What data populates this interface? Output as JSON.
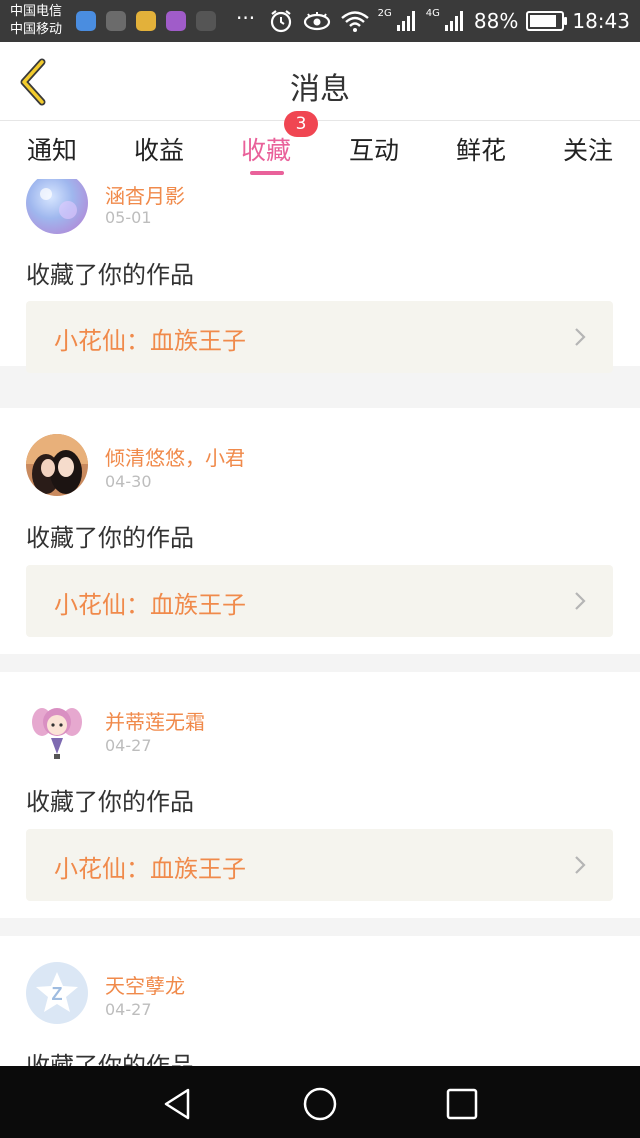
{
  "status_bar": {
    "carrier_1": "中国电信",
    "carrier_2": "中国移动",
    "more": "···",
    "net_2g": "2G",
    "net_4g": "4G",
    "battery_text": "88%",
    "battery_level": 0.88,
    "time": "18:43"
  },
  "header": {
    "title": "消息",
    "back_icon": "chevron-left-icon",
    "accent": "#e9619a"
  },
  "tabs": [
    {
      "label": "通知"
    },
    {
      "label": "收益"
    },
    {
      "label": "收藏",
      "active": true,
      "badge": "3"
    },
    {
      "label": "互动"
    },
    {
      "label": "鲜花"
    },
    {
      "label": "关注"
    }
  ],
  "messages": [
    {
      "user": "涵杳月影",
      "date": "05-01",
      "action": "收藏了你的作品",
      "work": "小花仙：血族王子"
    },
    {
      "user": "倾清悠悠，小君",
      "date": "04-30",
      "action": "收藏了你的作品",
      "work": "小花仙：血族王子"
    },
    {
      "user": "并蒂莲无霜",
      "date": "04-27",
      "action": "收藏了你的作品",
      "work": "小花仙：血族王子"
    },
    {
      "user": "天空孽龙",
      "date": "04-27",
      "action": "收藏了你的作品",
      "work": ""
    }
  ],
  "colors": {
    "username": "#f08a4b",
    "badge": "#f04652",
    "work_bg": "#f5f4ee"
  }
}
